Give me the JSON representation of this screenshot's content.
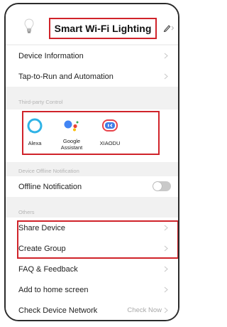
{
  "header": {
    "title": "Smart Wi-Fi Lighting"
  },
  "rows_top": [
    {
      "label": "Device Information"
    },
    {
      "label": "Tap-to-Run and Automation"
    }
  ],
  "sections": {
    "third_party": "Third-party Control",
    "offline": "Device Offline Notification",
    "others": "Others"
  },
  "third_party": [
    {
      "name": "Alexa",
      "icon": "alexa-icon"
    },
    {
      "name": "Google Assistant",
      "icon": "google-assistant-icon"
    },
    {
      "name": "XIAODU",
      "icon": "xiaodu-icon"
    }
  ],
  "offline": {
    "label": "Offline Notification",
    "enabled": false
  },
  "others": [
    {
      "label": "Share Device"
    },
    {
      "label": "Create Group"
    },
    {
      "label": "FAQ & Feedback"
    },
    {
      "label": "Add to home screen"
    },
    {
      "label": "Check Device Network",
      "value": "Check Now"
    }
  ],
  "colors": {
    "highlight": "#d0232a",
    "alexa": "#2fb3e6",
    "google_blue": "#4285f4",
    "google_red": "#ea4335",
    "google_yellow": "#fbbc05",
    "google_green": "#34a853",
    "xiaodu": "#3f7ce6"
  }
}
